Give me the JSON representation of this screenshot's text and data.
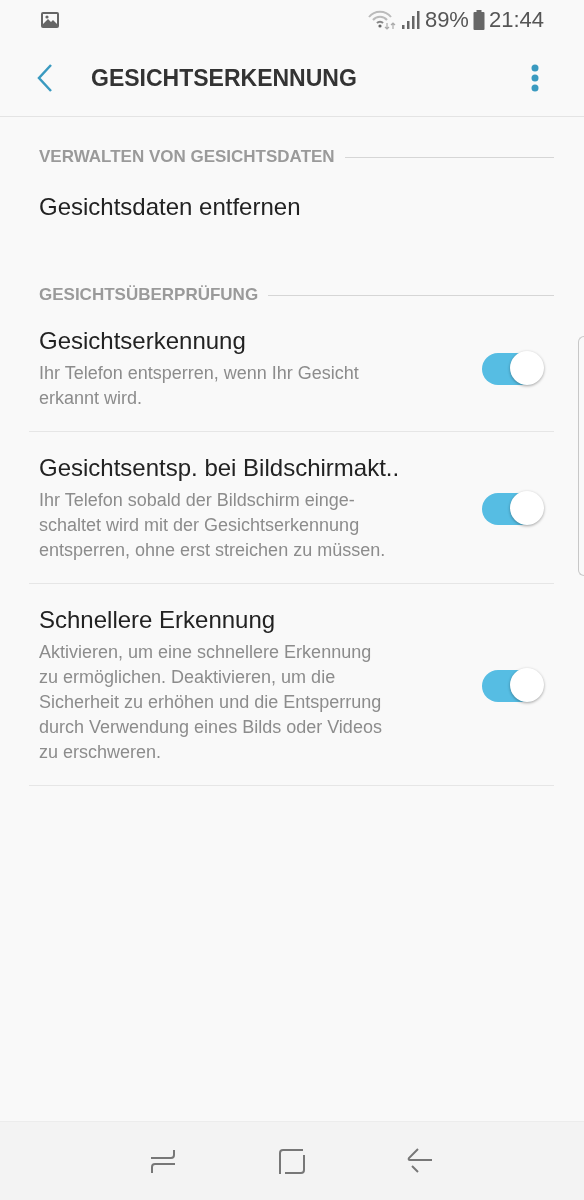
{
  "status_bar": {
    "battery": "89%",
    "time": "21:44"
  },
  "app_bar": {
    "title": "GESICHTSERKENNUNG"
  },
  "sections": [
    {
      "header": "VERWALTEN VON GESICHTSDATEN",
      "items": [
        {
          "kind": "action",
          "title": "Gesichtsdaten entfernen"
        }
      ]
    },
    {
      "header": "GESICHTSÜBERPRÜFUNG",
      "items": [
        {
          "kind": "switch",
          "title": "Gesichtserkennung",
          "description": [
            "Ihr Telefon entsperren, wenn Ihr Gesicht",
            "erkannt wird."
          ],
          "on": true
        },
        {
          "kind": "switch",
          "title": "Gesichtsentsp. bei Bildschirmakt..",
          "description": [
            "Ihr Telefon sobald der Bildschirm einge-",
            "schaltet wird mit der Gesichtserkennung",
            "entsperren, ohne erst streichen zu müssen."
          ],
          "on": true
        },
        {
          "kind": "switch",
          "title": "Schnellere Erkennung",
          "description": [
            "Aktivieren, um eine schnellere Erkennung",
            "zu ermöglichen. Deaktivieren, um die",
            "Sicherheit zu erhöhen und die Entsperrung",
            "durch Verwendung eines Bilds oder Videos",
            "zu erschweren."
          ],
          "on": true
        }
      ]
    }
  ]
}
